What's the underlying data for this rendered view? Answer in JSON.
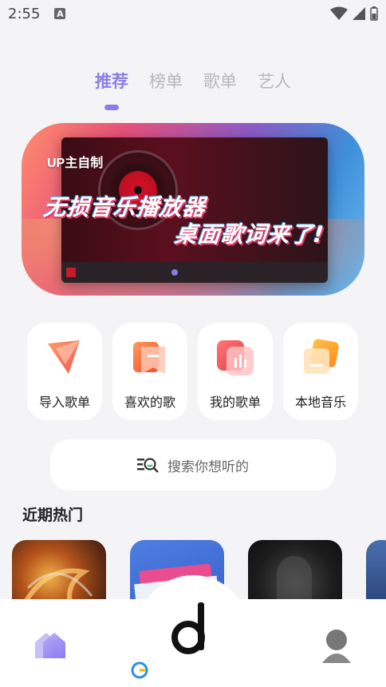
{
  "status_bar": {
    "time": "2:55",
    "notification_icon": "A"
  },
  "tabs": [
    {
      "label": "推荐",
      "active": true
    },
    {
      "label": "榜单",
      "active": false
    },
    {
      "label": "歌单",
      "active": false
    },
    {
      "label": "艺人",
      "active": false
    }
  ],
  "banner": {
    "tag": "UP主自制",
    "title_line1": "无损音乐播放器",
    "title_line2": "桌面歌词来了!"
  },
  "shortcuts": [
    {
      "label": "导入歌单",
      "icon": "import-icon"
    },
    {
      "label": "喜欢的歌",
      "icon": "favorite-icon"
    },
    {
      "label": "我的歌单",
      "icon": "playlist-icon"
    },
    {
      "label": "本地音乐",
      "icon": "local-music-icon"
    }
  ],
  "search": {
    "placeholder": "搜索你想听的"
  },
  "section": {
    "title": "近期热门"
  },
  "colors": {
    "accent": "#8b7de8",
    "background": "#f4f4f6"
  }
}
